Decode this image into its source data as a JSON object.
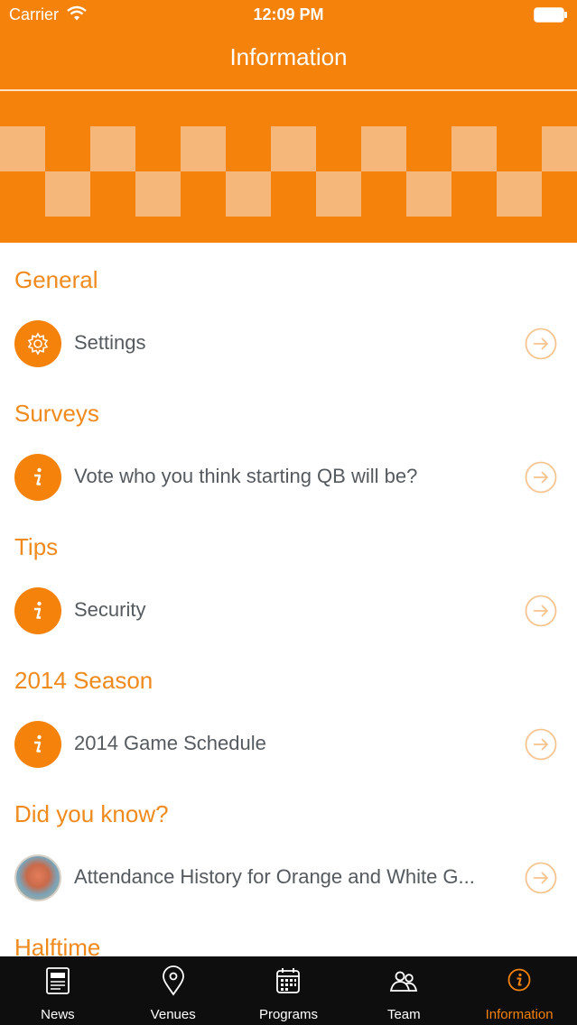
{
  "status_bar": {
    "carrier": "Carrier",
    "time": "12:09 PM"
  },
  "nav": {
    "title": "Information"
  },
  "colors": {
    "accent": "#f5820a",
    "section_text": "#f08a1c",
    "tab_bar": "#0e0e0e",
    "arrow": "#f6c48f"
  },
  "sections": [
    {
      "title": "General",
      "items": [
        {
          "label": "Settings",
          "icon": "gear-icon"
        }
      ]
    },
    {
      "title": "Surveys",
      "items": [
        {
          "label": "Vote who you think starting QB will be?",
          "icon": "info-icon"
        }
      ]
    },
    {
      "title": "Tips",
      "items": [
        {
          "label": "Security",
          "icon": "info-icon"
        }
      ]
    },
    {
      "title": "2014 Season",
      "items": [
        {
          "label": "2014 Game Schedule",
          "icon": "info-icon"
        }
      ]
    },
    {
      "title": "Did you know?",
      "items": [
        {
          "label": "Attendance History for Orange and White G...",
          "icon": "stadium-photo"
        }
      ]
    },
    {
      "title": "Halftime",
      "items": []
    }
  ],
  "tabs": [
    {
      "label": "News",
      "icon": "news-icon"
    },
    {
      "label": "Venues",
      "icon": "location-pin-icon"
    },
    {
      "label": "Programs",
      "icon": "calendar-icon"
    },
    {
      "label": "Team",
      "icon": "team-icon"
    },
    {
      "label": "Information",
      "icon": "info-icon",
      "active": true
    }
  ]
}
